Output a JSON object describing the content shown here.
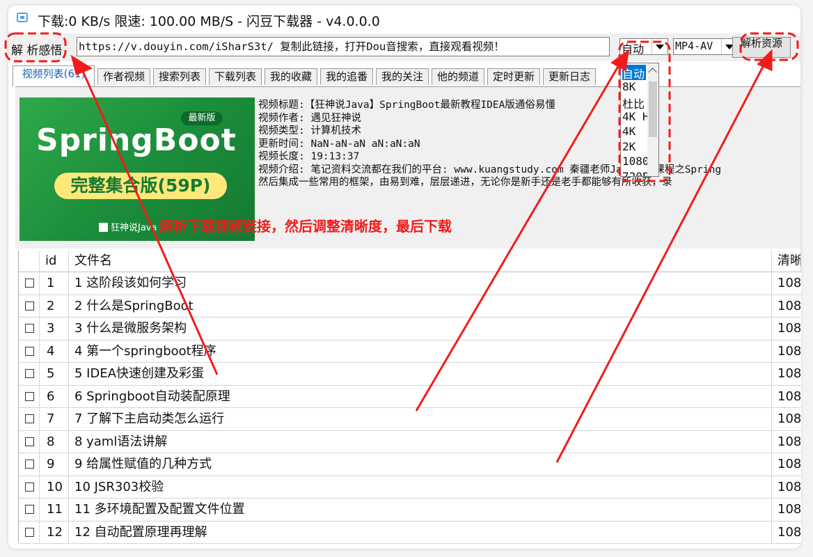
{
  "window": {
    "title": "下载:0 KB/s  限速: 100.00 MB/S  - 闪豆下载器 - v4.0.0.0"
  },
  "toolbar": {
    "parse_label": "解 析感悟",
    "url_value": "https://v.douyin.com/iSharS3t/ 复制此链接，打开Dou音搜索，直接观看视频！",
    "quality_value": "自动",
    "format_value": "MP4-AV",
    "parse_button": "解析资源"
  },
  "quality_dropdown": {
    "items": [
      "自动",
      "8K",
      "杜比",
      "4K H",
      "4K",
      "2K",
      "1080",
      "720P"
    ],
    "selected_index": 0
  },
  "tabs": [
    {
      "label": "视频列表(61)"
    },
    {
      "label": "作者视频"
    },
    {
      "label": "搜索列表"
    },
    {
      "label": "下载列表"
    },
    {
      "label": "我的收藏"
    },
    {
      "label": "我的追番"
    },
    {
      "label": "我的关注"
    },
    {
      "label": "他的频道"
    },
    {
      "label": "定时更新"
    },
    {
      "label": "更新日志"
    }
  ],
  "thumbnail": {
    "badge": "最新版",
    "title": "SpringBoot",
    "subtitle": "完整集合版(59P)",
    "logo_text": "狂神说Java"
  },
  "video_info": {
    "title_line": "视频标题:【狂神说Java】SpringBoot最新教程IDEA版通俗易懂",
    "author_line": "视频作者: 遇见狂神说",
    "type_line": "视频类型: 计算机技术",
    "updated_line": "更新时间: NaN-aN-aN aN:aN:aN",
    "duration_line": "视频长度: 19:13:37",
    "intro_line": "视频介绍: 笔记资料交流都在我们的平台: www.kuangstudy.com 秦疆老师Java系列课程之Spring",
    "intro_line2": "然后集成一些常用的框架，由易到难，层层递进，无论你是新手还是老手都能够有所收获，录"
  },
  "table": {
    "columns": [
      "id",
      "文件名",
      "清晰"
    ],
    "rows": [
      {
        "id": "1",
        "name": "1 这阶段该如何学习",
        "quality": "108"
      },
      {
        "id": "2",
        "name": "2 什么是SpringBoot",
        "quality": "108"
      },
      {
        "id": "3",
        "name": "3 什么是微服务架构",
        "quality": "108"
      },
      {
        "id": "4",
        "name": "4 第一个springboot程序",
        "quality": "108"
      },
      {
        "id": "5",
        "name": "5 IDEA快速创建及彩蛋",
        "quality": "108"
      },
      {
        "id": "6",
        "name": "6 Springboot自动装配原理",
        "quality": "108"
      },
      {
        "id": "7",
        "name": "7 了解下主启动类怎么运行",
        "quality": "108"
      },
      {
        "id": "8",
        "name": "8 yaml语法讲解",
        "quality": "108"
      },
      {
        "id": "9",
        "name": "9 给属性赋值的几种方式",
        "quality": "108"
      },
      {
        "id": "10",
        "name": "10 JSR303校验",
        "quality": "108"
      },
      {
        "id": "11",
        "name": "11 多环境配置及配置文件位置",
        "quality": "108"
      },
      {
        "id": "12",
        "name": "12 自动配置原理再理解",
        "quality": "108"
      }
    ]
  },
  "annotation": {
    "text": "解析下载视频链接，然后调整清晰度，最后下载",
    "color": "#f21b1b"
  }
}
